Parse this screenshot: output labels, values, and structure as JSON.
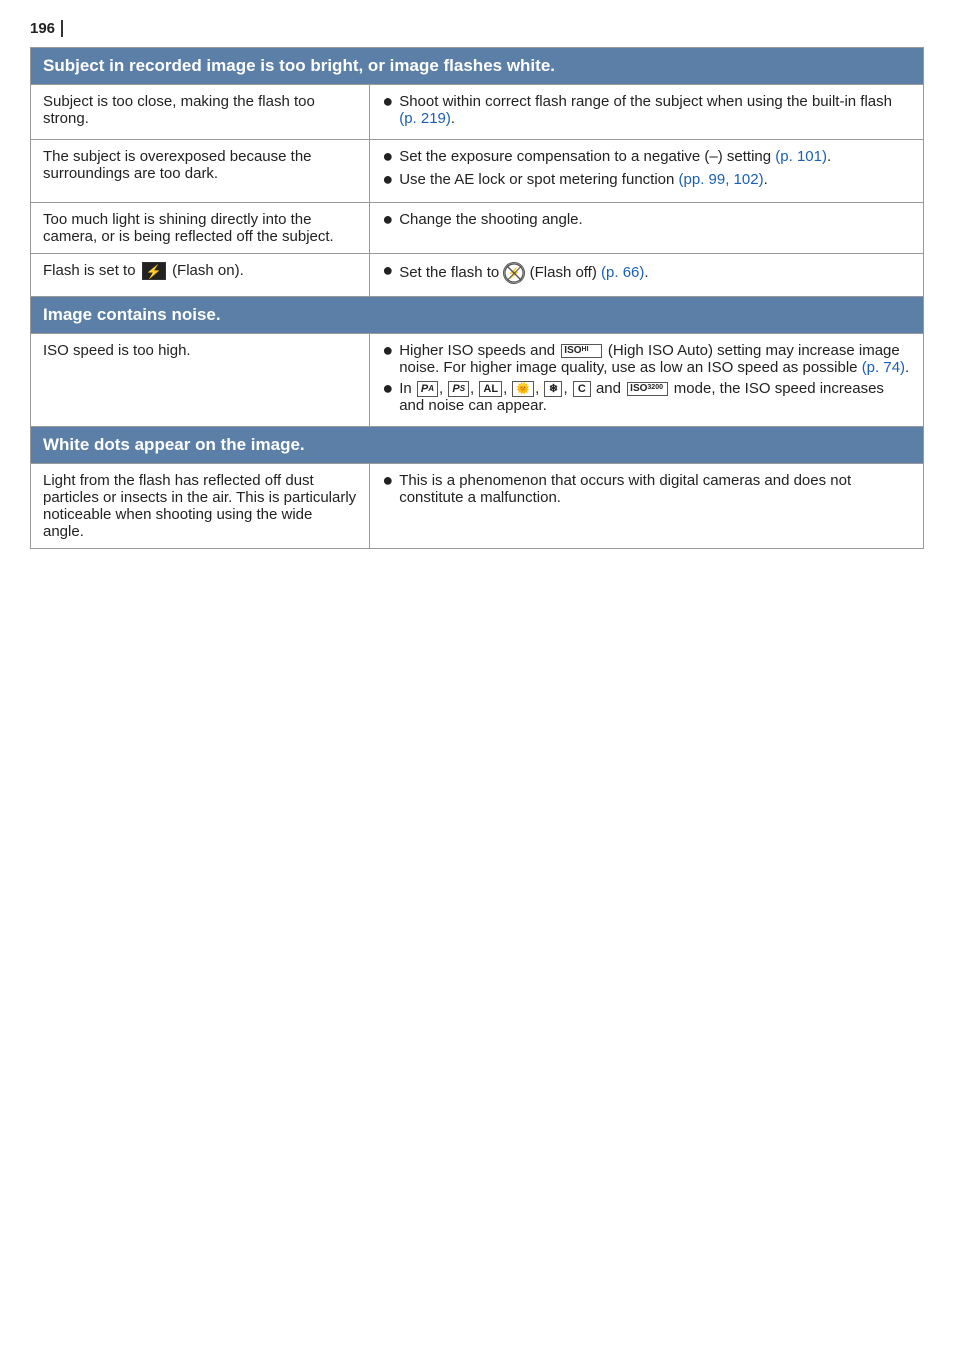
{
  "page": {
    "number": "196",
    "sections": [
      {
        "id": "section-bright",
        "header": "Subject in recorded image is too bright, or image flashes white.",
        "rows": [
          {
            "id": "row-too-close",
            "left": "Subject is too close, making the flash too strong.",
            "right": [
              {
                "text": "Shoot within correct flash range of the subject when using the built-in flash (p. 219).",
                "link": "p. 219"
              }
            ]
          },
          {
            "id": "row-overexposed",
            "left": "The subject is overexposed because the surroundings are too dark.",
            "right": [
              {
                "text": "Set the exposure compensation to a negative (–) setting (p. 101).",
                "link": "p. 101"
              },
              {
                "text": "Use the AE lock or spot metering function (pp. 99, 102).",
                "link": "pp. 99, 102"
              }
            ]
          },
          {
            "id": "row-light-shining",
            "left": "Too much light is shining directly into the camera, or is being reflected off the subject.",
            "right": [
              {
                "text": "Change the shooting angle.",
                "link": null
              }
            ]
          },
          {
            "id": "row-flash-on",
            "left": "Flash is set to [Flash on].",
            "right": [
              {
                "text": "Set the flash to [Flash off] (p. 66).",
                "link": "p. 66"
              }
            ]
          }
        ]
      },
      {
        "id": "section-noise",
        "header": "Image contains noise.",
        "rows": [
          {
            "id": "row-iso-high",
            "left": "ISO speed is too high.",
            "right": [
              {
                "text": "Higher ISO speeds and [High ISO Auto] setting may increase image noise. For higher image quality, use as low an ISO speed as possible (p. 74).",
                "link": "p. 74"
              },
              {
                "text": "In [modes], the ISO speed increases and noise can appear.",
                "has_icons": true
              }
            ]
          }
        ]
      },
      {
        "id": "section-dots",
        "header": "White dots appear on the image.",
        "rows": [
          {
            "id": "row-dust",
            "left": "Light from the flash has reflected off dust particles or insects in the air. This is particularly noticeable when shooting using the wide angle.",
            "right": [
              {
                "text": "This is a phenomenon that occurs with digital cameras and does not constitute a malfunction.",
                "link": null
              }
            ]
          }
        ]
      }
    ]
  }
}
